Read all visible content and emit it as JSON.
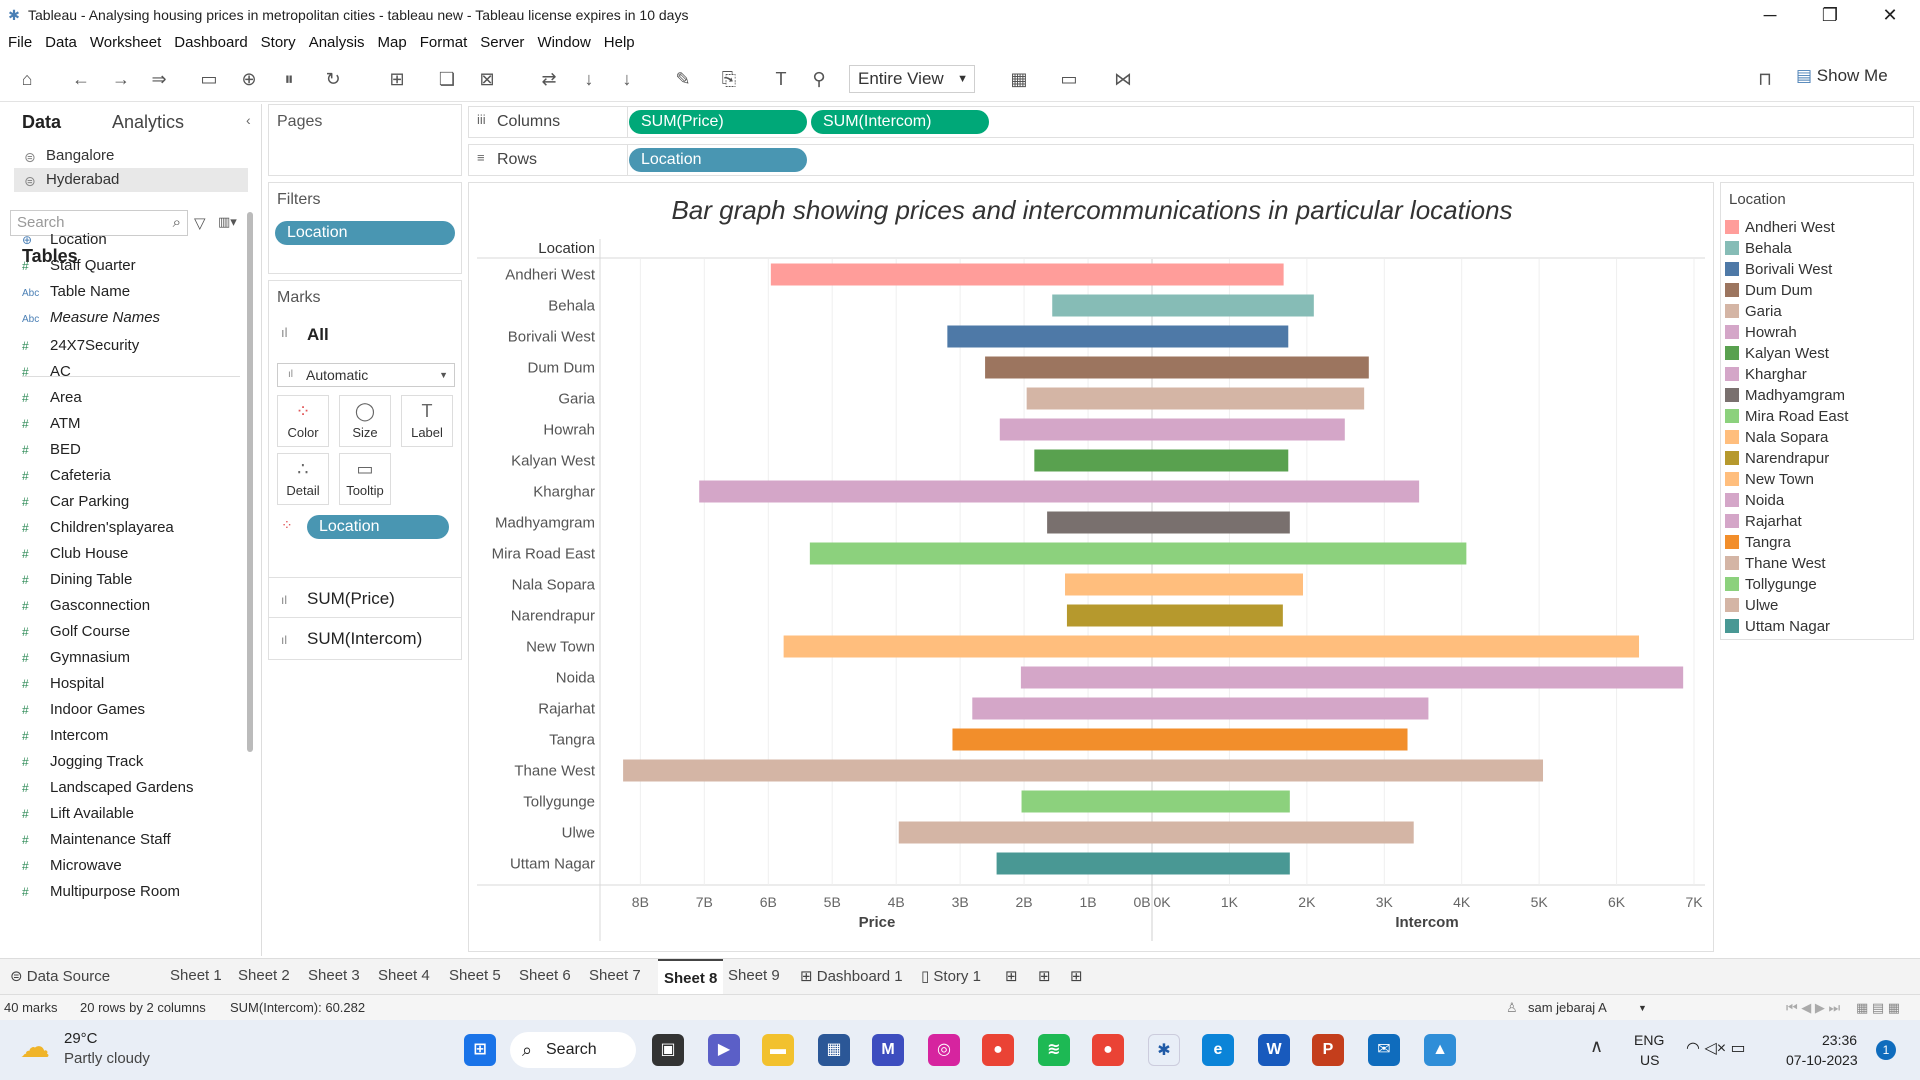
{
  "window": {
    "title": "Tableau - Analysing housing prices in metropolitan cities - tableau new - Tableau license expires in 10 days",
    "controls": [
      "─",
      "❐",
      "✕"
    ]
  },
  "menu": [
    "File",
    "Data",
    "Worksheet",
    "Dashboard",
    "Story",
    "Analysis",
    "Map",
    "Format",
    "Server",
    "Window",
    "Help"
  ],
  "toolbar": {
    "fit": "Entire View",
    "show_me": "Show Me"
  },
  "data_pane": {
    "tabs": [
      "Data",
      "Analytics"
    ],
    "datasources": [
      "Bangalore",
      "Hyderabad"
    ],
    "search_placeholder": "Search",
    "tables_label": "Tables",
    "fields": [
      {
        "name": "Location",
        "type": "geo"
      },
      {
        "name": "Staff Quarter",
        "type": "num"
      },
      {
        "name": "Table Name",
        "type": "abc"
      },
      {
        "name": "Measure Names",
        "type": "abc"
      },
      {
        "name": "24X7Security",
        "type": "num"
      },
      {
        "name": "AC",
        "type": "num"
      },
      {
        "name": "Area",
        "type": "num"
      },
      {
        "name": "ATM",
        "type": "num"
      },
      {
        "name": "BED",
        "type": "num"
      },
      {
        "name": "Cafeteria",
        "type": "num"
      },
      {
        "name": "Car Parking",
        "type": "num"
      },
      {
        "name": "Children'splayarea",
        "type": "num"
      },
      {
        "name": "Club House",
        "type": "num"
      },
      {
        "name": "Dining Table",
        "type": "num"
      },
      {
        "name": "Gasconnection",
        "type": "num"
      },
      {
        "name": "Golf Course",
        "type": "num"
      },
      {
        "name": "Gymnasium",
        "type": "num"
      },
      {
        "name": "Hospital",
        "type": "num"
      },
      {
        "name": "Indoor Games",
        "type": "num"
      },
      {
        "name": "Intercom",
        "type": "num"
      },
      {
        "name": "Jogging Track",
        "type": "num"
      },
      {
        "name": "Landscaped Gardens",
        "type": "num"
      },
      {
        "name": "Lift Available",
        "type": "num"
      },
      {
        "name": "Maintenance Staff",
        "type": "num"
      },
      {
        "name": "Microwave",
        "type": "num"
      },
      {
        "name": "Multipurpose Room",
        "type": "num"
      }
    ]
  },
  "cards": {
    "pages": "Pages",
    "filters": "Filters",
    "filter_pill": "Location",
    "marks": "Marks",
    "marks_all": "All",
    "mark_type": "Automatic",
    "mark_buttons": [
      "Color",
      "Size",
      "Label",
      "Detail",
      "Tooltip"
    ],
    "marks_pill": "Location",
    "measures": [
      "SUM(Price)",
      "SUM(Intercom)"
    ]
  },
  "shelves": {
    "columns_label": "Columns",
    "rows_label": "Rows",
    "columns": [
      "SUM(Price)",
      "SUM(Intercom)"
    ],
    "rows": [
      "Location"
    ]
  },
  "chart_data": {
    "type": "bar",
    "title": "Bar graph showing prices and intercommunications in particular locations",
    "row_header": "Location",
    "categories": [
      "Andheri West",
      "Behala",
      "Borivali West",
      "Dum Dum",
      "Garia",
      "Howrah",
      "Kalyan West",
      "Kharghar",
      "Madhyamgram",
      "Mira Road East",
      "Nala Sopara",
      "Narendrapur",
      "New Town",
      "Noida",
      "Rajarhat",
      "Tangra",
      "Thane West",
      "Tollygunge",
      "Ulwe",
      "Uttam Nagar"
    ],
    "colors": [
      "#ff9d9a",
      "#86bcb6",
      "#4e79a7",
      "#9c755f",
      "#d4b5a5",
      "#d4a6c8",
      "#59a14f",
      "#d4a6c8",
      "#79706e",
      "#8cd17d",
      "#ffbe7d",
      "#b6992d",
      "#ffbe7d",
      "#d4a6c8",
      "#d4a6c8",
      "#f28e2b",
      "#d4b5a5",
      "#8cd17d",
      "#d4b5a5",
      "#499894"
    ],
    "series": [
      {
        "name": "Price",
        "values": [
          5.96,
          1.56,
          3.2,
          2.61,
          1.96,
          2.38,
          1.84,
          7.08,
          1.64,
          5.35,
          1.36,
          1.33,
          5.76,
          2.05,
          2.81,
          3.12,
          8.27,
          2.04,
          3.96,
          2.43
        ]
      },
      {
        "name": "Intercom",
        "values": [
          1700,
          2090,
          1760,
          2800,
          2740,
          2490,
          1760,
          3450,
          1780,
          4060,
          1950,
          1690,
          6290,
          6860,
          3570,
          3300,
          5050,
          1780,
          3380,
          1780
        ]
      }
    ],
    "axes": [
      {
        "label": "Price",
        "ticks": [
          "8B",
          "7B",
          "6B",
          "5B",
          "4B",
          "3B",
          "2B",
          "1B",
          "0B"
        ],
        "range": [
          0,
          8.6
        ],
        "reversed": true
      },
      {
        "label": "Intercom",
        "ticks": [
          "0K",
          "1K",
          "2K",
          "3K",
          "4K",
          "5K",
          "6K",
          "7K"
        ],
        "range": [
          0,
          7000
        ],
        "reversed": false
      }
    ],
    "grid": true
  },
  "legend": {
    "title": "Location",
    "items": [
      "Andheri West",
      "Behala",
      "Borivali West",
      "Dum Dum",
      "Garia",
      "Howrah",
      "Kalyan West",
      "Kharghar",
      "Madhyamgram",
      "Mira Road East",
      "Nala Sopara",
      "Narendrapur",
      "New Town",
      "Noida",
      "Rajarhat",
      "Tangra",
      "Thane West",
      "Tollygunge",
      "Ulwe",
      "Uttam Nagar"
    ]
  },
  "sheet_tabs": {
    "data_source": "Data Source",
    "tabs": [
      "Sheet 1",
      "Sheet 2",
      "Sheet 3",
      "Sheet 4",
      "Sheet 5",
      "Sheet 6",
      "Sheet 7",
      "Sheet 8",
      "Sheet 9",
      "Dashboard 1",
      "Story 1"
    ],
    "active": "Sheet 8"
  },
  "status": {
    "marks": "40 marks",
    "rows": "20 rows by 2 columns",
    "sum": "SUM(Intercom): 60.282",
    "user": "sam jebaraj A"
  },
  "taskbar": {
    "weather_temp": "29°C",
    "weather_desc": "Partly cloudy",
    "search": "Search",
    "lang1": "ENG",
    "lang2": "US",
    "time": "23:36",
    "date": "07-10-2023",
    "notif": "1"
  }
}
